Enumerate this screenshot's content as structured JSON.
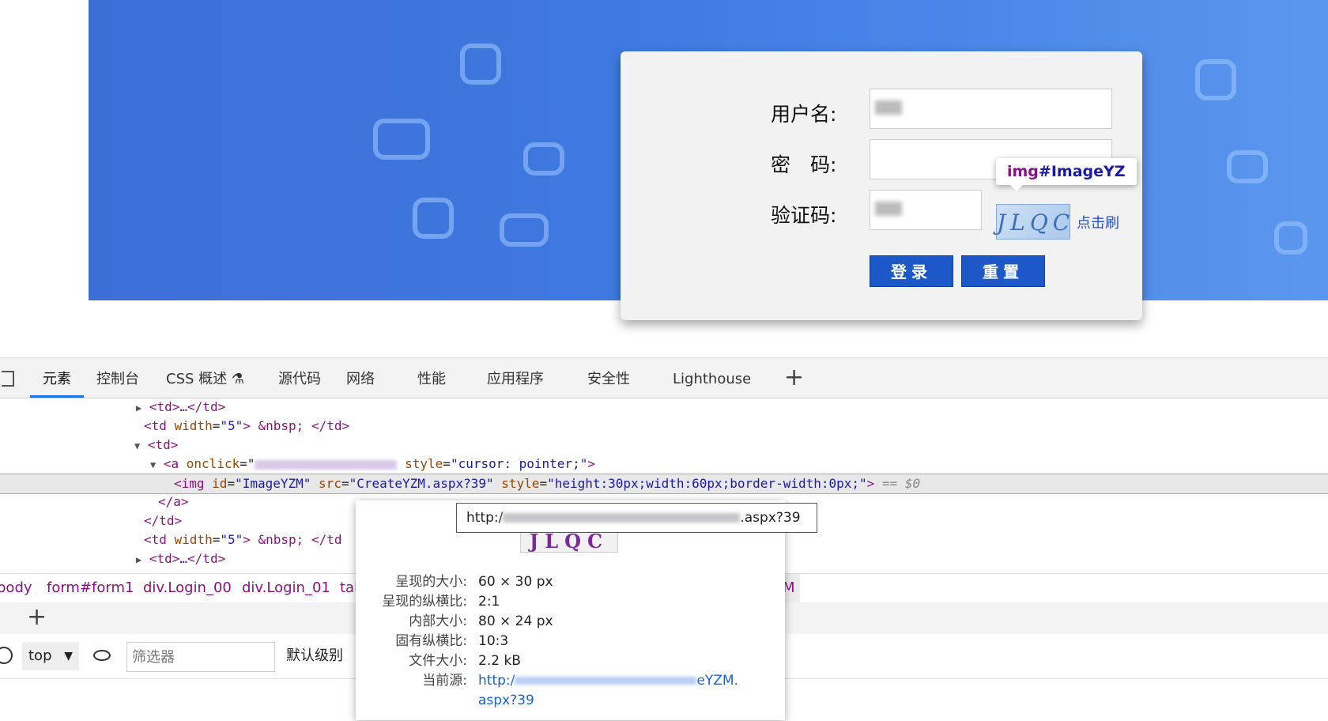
{
  "login": {
    "username_label": "用户名:",
    "password_label": "密　码:",
    "captcha_label": "验证码:",
    "captcha_text": "JLQC",
    "refresh_link": "点击刷",
    "login_button": "登录",
    "reset_button": "重置",
    "hover_tag": "img",
    "hover_id": "#ImageYZ"
  },
  "devtools": {
    "tabs": [
      "元素",
      "控制台",
      "CSS 概述 ⚗",
      "源代码",
      "网络",
      "性能",
      "应用程序",
      "安全性",
      "Lighthouse"
    ],
    "active_tab": "元素",
    "dom": {
      "l1": "<td>…</td>",
      "l2_tag_open": "<td ",
      "l2_attr": "width",
      "l2_val": "\"5\"",
      "l2_rest": "> &nbsp; </td>",
      "l3": "<td>",
      "l4_a": "<a ",
      "l4_attr1": "onclick",
      "l4_attr2": "style",
      "l4_val2": "\"cursor: pointer;\"",
      "l5_tag": "<img ",
      "l5_id_attr": "id",
      "l5_id_val": "\"ImageYZM\"",
      "l5_src_attr": "src",
      "l5_src_val": "\"CreateYZM.aspx?39\"",
      "l5_style_attr": "style",
      "l5_style_val": "\"height:30px;width:60px;border-width:0px;\"",
      "l5_close": ">",
      "l5_eq": "== $0",
      "l6": "</a>",
      "l7": "</td>",
      "l8_tail": "> &nbsp; </td",
      "l9": "<td>…</td>"
    },
    "breadcrumbs": [
      "body",
      "form#form1",
      "div.Login_00",
      "div.Login_01",
      "tal",
      "M"
    ],
    "console": {
      "context": "top",
      "filter_placeholder": "筛选器",
      "level": "默认级别"
    }
  },
  "preview": {
    "url_prefix": "http:/",
    "url_suffix": ".aspx?39",
    "thumb_text": "JLQC",
    "rows": [
      {
        "k": "呈现的大小:",
        "v": "60 × 30 px"
      },
      {
        "k": "呈现的纵横比:",
        "v": "2:1"
      },
      {
        "k": "内部大小:",
        "v": "80 × 24 px"
      },
      {
        "k": "固有纵横比:",
        "v": "10:3"
      },
      {
        "k": "文件大小:",
        "v": "2.2 kB"
      }
    ],
    "source_label": "当前源:",
    "source_prefix": "http:/",
    "source_suffix": "eYZM.",
    "source_line2": "aspx?39"
  }
}
